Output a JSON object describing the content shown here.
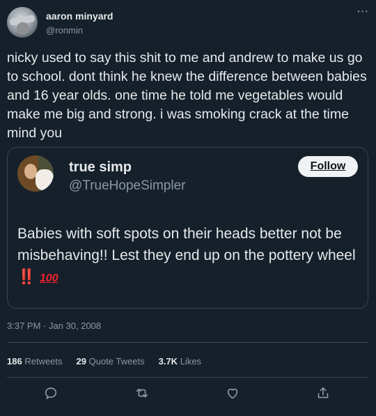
{
  "author": {
    "display_name": "aaron minyard",
    "handle": "@ronmin"
  },
  "menu": {
    "more_label": "···"
  },
  "tweet_text": "nicky used to say this shit to me and andrew to make us go to school.  dont think he knew the difference between babies and 16 year olds. one time he told me vegetables would make me big and strong. i was smoking crack at the time mind you",
  "quoted": {
    "display_name": "true simp",
    "handle": "@TrueHopeSimpler",
    "follow_label": "Follow",
    "text": "Babies with soft spots on their heads better not be misbehaving!! Lest they end up on the pottery wheel",
    "emoji_bangbang": "‼️",
    "emoji_hundred": "100"
  },
  "timestamp": "3:37 PM · Jan 30, 2008",
  "stats": {
    "retweets_count": "186",
    "retweets_label": "Retweets",
    "quotes_count": "29",
    "quotes_label": "Quote Tweets",
    "likes_count": "3.7K",
    "likes_label": "Likes"
  },
  "icons": [
    "reply-icon",
    "retweet-icon",
    "like-icon",
    "share-icon"
  ]
}
